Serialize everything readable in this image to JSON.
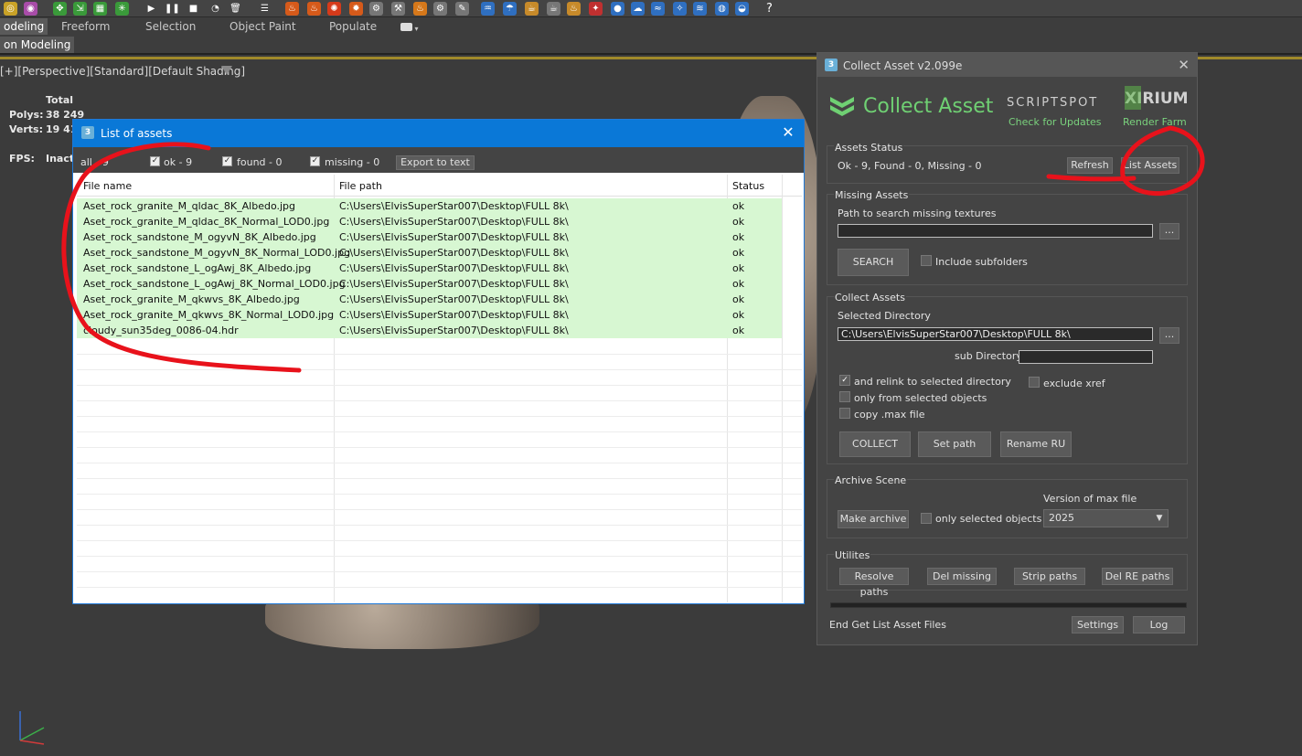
{
  "ribbon": {
    "tabs": [
      "odeling",
      "Freeform",
      "Selection",
      "Object Paint",
      "Populate"
    ],
    "sub_label": "on Modeling"
  },
  "viewport": {
    "label": "[+][Perspective][Standard][Default Shading]",
    "stats_header": "Total",
    "polys_label": "Polys:",
    "polys_value": "38 249",
    "verts_label": "Verts:",
    "verts_value": "19 41",
    "fps_label": "FPS:",
    "fps_value": "Inact"
  },
  "assets_window": {
    "title": "List of assets",
    "filters": [
      {
        "label": "all - 9",
        "checked": false
      },
      {
        "label": "ok - 9",
        "checked": true
      },
      {
        "label": "found - 0",
        "checked": true
      },
      {
        "label": "missing - 0",
        "checked": true
      }
    ],
    "export_label": "Export to text",
    "columns": [
      "File name",
      "File path",
      "Status"
    ],
    "rows": [
      {
        "name": "Aset_rock_granite_M_qldac_8K_Albedo.jpg",
        "path": "C:\\Users\\ElvisSuperStar007\\Desktop\\FULL 8k\\",
        "status": "ok"
      },
      {
        "name": "Aset_rock_granite_M_qldac_8K_Normal_LOD0.jpg",
        "path": "C:\\Users\\ElvisSuperStar007\\Desktop\\FULL 8k\\",
        "status": "ok"
      },
      {
        "name": "Aset_rock_sandstone_M_ogyvN_8K_Albedo.jpg",
        "path": "C:\\Users\\ElvisSuperStar007\\Desktop\\FULL 8k\\",
        "status": "ok"
      },
      {
        "name": "Aset_rock_sandstone_M_ogyvN_8K_Normal_LOD0.jpg",
        "path": "C:\\Users\\ElvisSuperStar007\\Desktop\\FULL 8k\\",
        "status": "ok"
      },
      {
        "name": "Aset_rock_sandstone_L_ogAwj_8K_Albedo.jpg",
        "path": "C:\\Users\\ElvisSuperStar007\\Desktop\\FULL 8k\\",
        "status": "ok"
      },
      {
        "name": "Aset_rock_sandstone_L_ogAwj_8K_Normal_LOD0.jpg",
        "path": "C:\\Users\\ElvisSuperStar007\\Desktop\\FULL 8k\\",
        "status": "ok"
      },
      {
        "name": "Aset_rock_granite_M_qkwvs_8K_Albedo.jpg",
        "path": "C:\\Users\\ElvisSuperStar007\\Desktop\\FULL 8k\\",
        "status": "ok"
      },
      {
        "name": "Aset_rock_granite_M_qkwvs_8K_Normal_LOD0.jpg",
        "path": "C:\\Users\\ElvisSuperStar007\\Desktop\\FULL 8k\\",
        "status": "ok"
      },
      {
        "name": "cloudy_sun35deg_0086-04.hdr",
        "path": "C:\\Users\\ElvisSuperStar007\\Desktop\\FULL 8k\\",
        "status": "ok"
      }
    ]
  },
  "collect": {
    "title": "Collect Asset v2.099e",
    "logo": "Collect Asset",
    "scriptspot": "SCRIPTSPOT",
    "check_updates": "Check for Updates",
    "xirium": "XIRIUM",
    "render_farm": "Render Farm",
    "status_group": "Assets Status",
    "status_text": "Ok - 9, Found - 0, Missing - 0",
    "refresh": "Refresh",
    "list_assets": "List Assets",
    "missing_group": "Missing Assets",
    "path_label": "Path to search missing textures",
    "path_value": "",
    "browse": "...",
    "search": "SEARCH",
    "include_sub": "Include subfolders",
    "collect_group": "Collect Assets",
    "selected_dir_label": "Selected Directory",
    "selected_dir": "C:\\Users\\ElvisSuperStar007\\Desktop\\FULL 8k\\",
    "sub_dir_label": "sub Directory",
    "sub_dir": "",
    "relink": "and relink to selected directory",
    "exclude_xref": "exclude xref",
    "only_selected": "only from selected objects",
    "copy_max": "copy .max file",
    "collect_btn": "COLLECT",
    "set_path": "Set path",
    "rename_ru": "Rename RU",
    "archive_group": "Archive Scene",
    "version_label": "Version of max file",
    "make_archive": "Make archive",
    "only_sel_obj": "only selected objects",
    "version": "2025",
    "utils_group": "Utilites",
    "resolve": "Resolve paths",
    "del_missing": "Del missing",
    "strip": "Strip paths",
    "del_re": "Del RE paths",
    "status_bar": "End Get List Asset Files",
    "settings": "Settings",
    "log": "Log"
  },
  "colors": {
    "ok_row": "#d7f7d2",
    "title_blue": "#0a78d7",
    "brand_green": "#6fd073",
    "annotation": "#e8121b"
  }
}
